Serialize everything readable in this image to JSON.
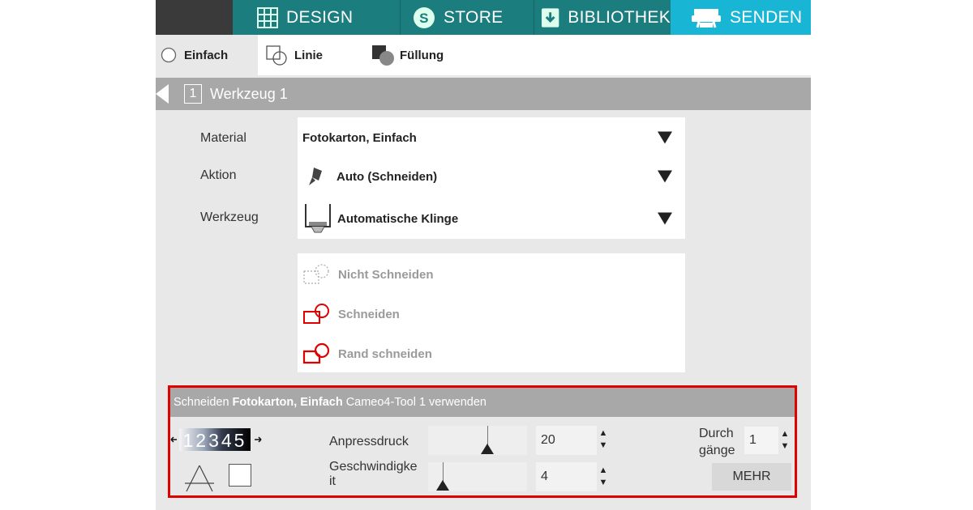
{
  "nav": {
    "tabs": [
      {
        "label": "DESIGN",
        "icon": "grid-icon"
      },
      {
        "label": "STORE",
        "icon": "store-s-icon"
      },
      {
        "label": "BIBLIOTHEK",
        "icon": "library-download-icon"
      },
      {
        "label": "SENDEN",
        "icon": "send-cutter-icon",
        "active": true
      }
    ]
  },
  "mode_tabs": [
    {
      "label": "Einfach",
      "active": true
    },
    {
      "label": "Linie"
    },
    {
      "label": "Füllung"
    }
  ],
  "tool_header": {
    "number": "1",
    "title": "Werkzeug 1"
  },
  "settings": {
    "material_label": "Material",
    "material_value": "Fotokarton, Einfach",
    "action_label": "Aktion",
    "action_value": "Auto (Schneiden)",
    "tool_label": "Werkzeug",
    "tool_value": "Automatische Klinge"
  },
  "cut_modes": [
    {
      "label": "Nicht Schneiden"
    },
    {
      "label": "Schneiden"
    },
    {
      "label": "Rand schneiden"
    }
  ],
  "panel": {
    "header_prefix": "Schneiden",
    "header_material": "Fotokarton, Einfach",
    "header_suffix": "Cameo4-Tool 1 verwenden",
    "blade_digits": "12345",
    "pressure_label": "Anpressdruck",
    "pressure_value": "20",
    "speed_label_1": "Geschwindigke",
    "speed_label_2": "it",
    "speed_value": "4",
    "passes_label_1": "Durch",
    "passes_label_2": "gänge",
    "passes_value": "1",
    "more_button": "MEHR"
  },
  "colors": {
    "nav_bg": "#1b7d7d",
    "nav_active": "#19b5d4",
    "highlight_border": "#e00000",
    "cut_red": "#e00000"
  }
}
